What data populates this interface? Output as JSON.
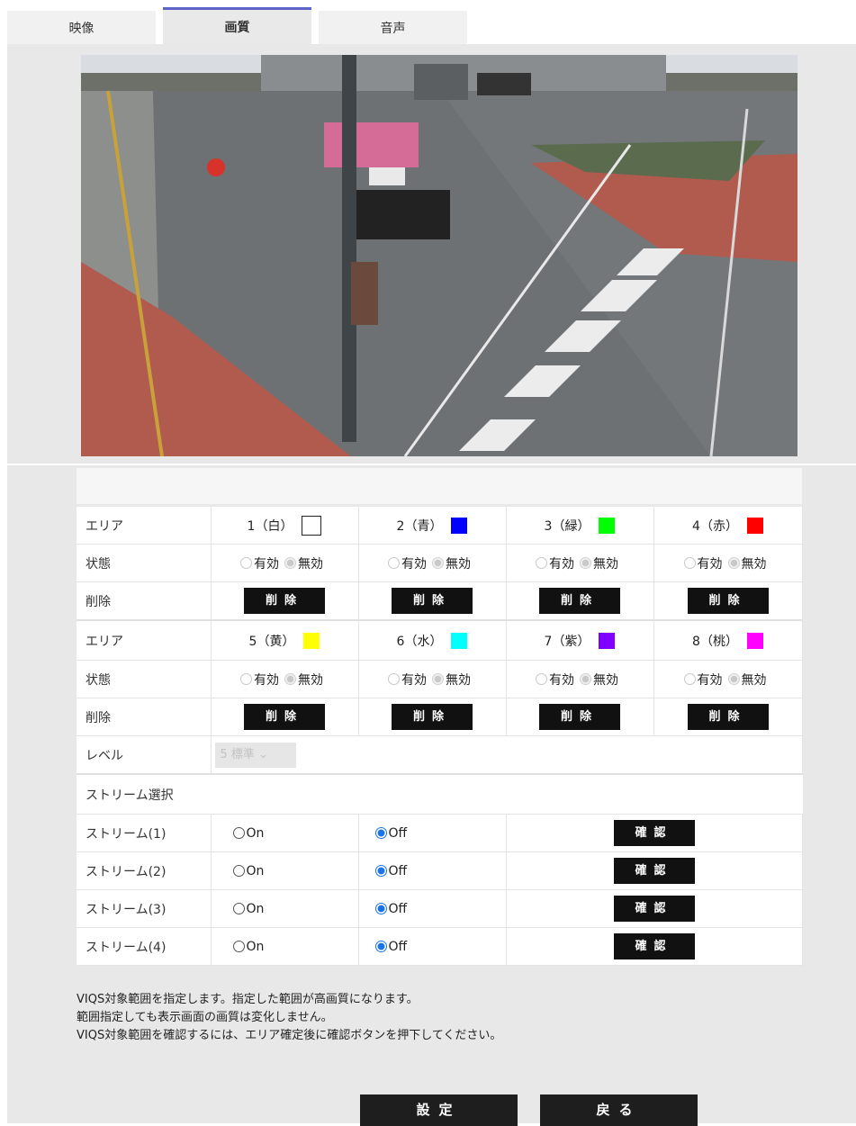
{
  "tabs": [
    {
      "label": "映像"
    },
    {
      "label": "画質"
    },
    {
      "label": "音声"
    }
  ],
  "areas_row1": [
    {
      "label": "1（白）",
      "color": "#ffffff"
    },
    {
      "label": "2（青）",
      "color": "#0000ff"
    },
    {
      "label": "3（緑）",
      "color": "#00ff00"
    },
    {
      "label": "4（赤）",
      "color": "#ff0000"
    }
  ],
  "areas_row2": [
    {
      "label": "5（黄）",
      "color": "#ffff00"
    },
    {
      "label": "6（水）",
      "color": "#00ffff"
    },
    {
      "label": "7（紫）",
      "color": "#8000ff"
    },
    {
      "label": "8（桃）",
      "color": "#ff00ff"
    }
  ],
  "labels": {
    "area": "エリア",
    "state": "状態",
    "delete": "削除",
    "level": "レベル",
    "stream_select": "ストリーム選択"
  },
  "radio": {
    "enabled": "有効",
    "disabled": "無効",
    "on": "On",
    "off": "Off"
  },
  "buttons": {
    "delete": "削除",
    "confirm": "確認",
    "set": "設定",
    "back": "戻る"
  },
  "level": {
    "value": "5 標準"
  },
  "streams": [
    {
      "label": "ストリーム(1)"
    },
    {
      "label": "ストリーム(2)"
    },
    {
      "label": "ストリーム(3)"
    },
    {
      "label": "ストリーム(4)"
    }
  ],
  "notes": [
    "VIQS対象範囲を指定します。指定した範囲が高画質になります。",
    "範囲指定しても表示画面の画質は変化しません。",
    "VIQS対象範囲を確認するには、エリア確定後に確認ボタンを押下してください。"
  ]
}
